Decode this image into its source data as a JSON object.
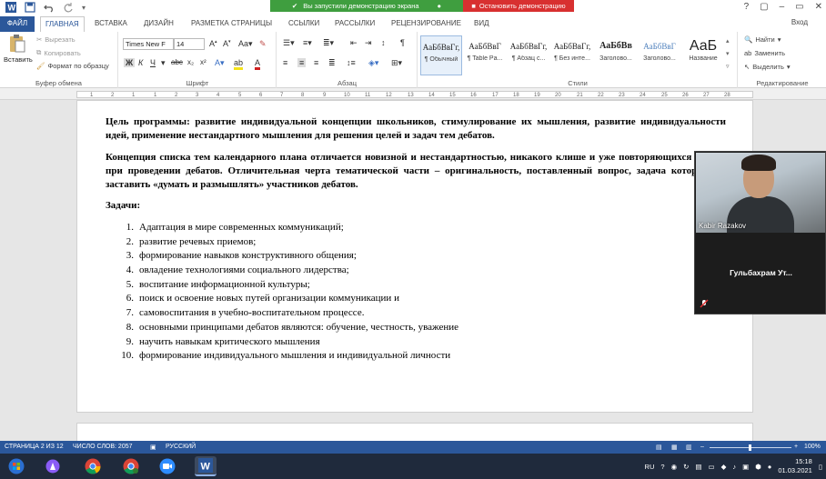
{
  "titlebar": {
    "sharing_notice": "Вы запустили демонстрацию экрана",
    "stop_sharing": "Остановить демонстрацию",
    "window_controls": [
      "?",
      "▢",
      "–",
      "▭",
      "✕"
    ]
  },
  "tabs": {
    "file": "ФАЙЛ",
    "items": [
      "ГЛАВНАЯ",
      "ВСТАВКА",
      "ДИЗАЙН",
      "РАЗМЕТКА СТРАНИЦЫ",
      "ССЫЛКИ",
      "РАССЫЛКИ",
      "РЕЦЕНЗИРОВАНИЕ",
      "ВИД"
    ],
    "signin": "Вход"
  },
  "ribbon": {
    "clipboard": {
      "paste": "Вставить",
      "cut": "Вырезать",
      "copy": "Копировать",
      "format_painter": "Формат по образцу",
      "label": "Буфер обмена"
    },
    "font": {
      "name": "Times New F",
      "size": "14",
      "label": "Шрифт"
    },
    "paragraph": {
      "label": "Абзац"
    },
    "styles": {
      "label": "Стили",
      "items": [
        {
          "preview": "АаБбВвГг,",
          "name": "¶ Обычный"
        },
        {
          "preview": "АаБбВвГ",
          "name": "¶ Table Pa..."
        },
        {
          "preview": "АаБбВвГг,",
          "name": "¶ Абзац с..."
        },
        {
          "preview": "АаБбВвГг,",
          "name": "¶ Без инте..."
        },
        {
          "preview": "АаБбВв",
          "name": "Заголово..."
        },
        {
          "preview": "АаБбВвГ",
          "name": "Заголово..."
        },
        {
          "preview": "АаБ",
          "name": "Название"
        }
      ]
    },
    "editing": {
      "find": "Найти",
      "replace": "Заменить",
      "select": "Выделить",
      "label": "Редактирование"
    }
  },
  "ruler": {
    "numbers": [
      "1",
      "2",
      "1",
      "1",
      "2",
      "3",
      "4",
      "5",
      "6",
      "7",
      "8",
      "9",
      "10",
      "11",
      "12",
      "13",
      "14",
      "15",
      "16",
      "17",
      "18",
      "19",
      "20",
      "21",
      "22",
      "23",
      "24",
      "25",
      "26",
      "27",
      "28"
    ]
  },
  "document": {
    "goal": "Цель программы: развитие индивидуальной концепции школьников, стимулирование их мышления, развитие индивидуальности идей, применение нестандартного мышления для решения целей и задач тем дебатов.",
    "concept": "Концепция списка тем календарного плана отличается новизной и нестандартностью, никакого клише и уже повторяющихся тем при проведении дебатов. Отличительная черта тематической части – оригинальность, поставленный вопрос, задача которого заставить «думать и размышлять» участников дебатов.",
    "tasks_heading": "Задачи:",
    "tasks": [
      {
        "num": "1.",
        "text": "Адаптация в мире современных коммуникаций;"
      },
      {
        "num": "2.",
        "text": "развитие речевых приемов;"
      },
      {
        "num": "3.",
        "text": "формирование навыков конструктивного общения;"
      },
      {
        "num": "4.",
        "text": "овладение технологиями социального лидерства;"
      },
      {
        "num": "5.",
        "text": "воспитание информационной культуры;"
      },
      {
        "num": "6.",
        "text": "поиск и освоение новых путей организации коммуникации и"
      },
      {
        "num": "7.",
        "text": "самовоспитания в учебно-воспитательном процессе."
      },
      {
        "num": "8.",
        "text": "основными принципами дебатов являются: обучение, честность, уважение"
      },
      {
        "num": "9.",
        "text": "научить навыкам критического мышления"
      },
      {
        "num": "10.",
        "text": "формирование индивидуального мышления и индивидуальной личности"
      }
    ]
  },
  "video": {
    "speaker": "Kabir Razakov",
    "participant": "Гульбахрам  Ут..."
  },
  "statusbar": {
    "page": "СТРАНИЦА 2 ИЗ 12",
    "words": "ЧИСЛО СЛОВ: 2057",
    "language": "РУССКИЙ",
    "zoom": "100%"
  },
  "taskbar": {
    "lang": "RU",
    "time": "15:18",
    "date": "01.03.2021"
  }
}
